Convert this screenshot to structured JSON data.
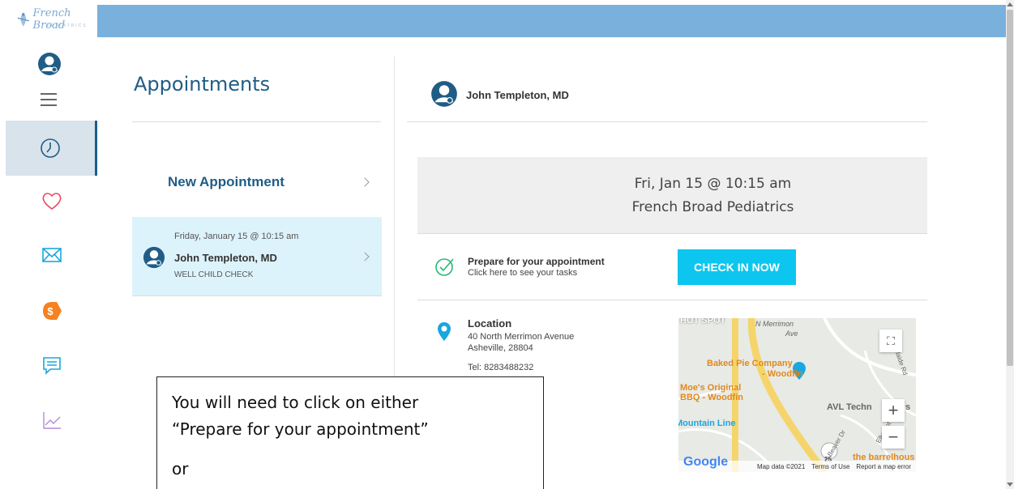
{
  "logo": {
    "text": "French Broad",
    "sub": "PEDIATRICS"
  },
  "nav": {
    "items": [
      {
        "name": "appointments",
        "icon": "clock-icon",
        "active": true
      },
      {
        "name": "health",
        "icon": "heart-icon",
        "active": false
      },
      {
        "name": "messages",
        "icon": "envelope-icon",
        "active": false
      },
      {
        "name": "billing",
        "icon": "dollar-icon",
        "active": false
      },
      {
        "name": "chat",
        "icon": "chat-icon",
        "active": false
      },
      {
        "name": "trends",
        "icon": "chart-icon",
        "active": false
      }
    ]
  },
  "appointments": {
    "title": "Appointments",
    "new_label": "New Appointment",
    "list": [
      {
        "date": "Friday, January 15 @ 10:15 am",
        "doctor": "John Templeton, MD",
        "type": "WELL CHILD CHECK"
      }
    ]
  },
  "detail": {
    "doctor": "John Templeton, MD",
    "when": "Fri, Jan 15 @ 10:15 am",
    "where": "French Broad Pediatrics",
    "prepare_title": "Prepare for your appointment",
    "prepare_sub": "Click here to see your tasks",
    "checkin_label": "CHECK IN NOW",
    "location_title": "Location",
    "address1": "40 North Merrimon Avenue",
    "address2": "Asheville, 28804",
    "phone": "Tel: 8283488232"
  },
  "map": {
    "labels": {
      "hotspot": "HOT SPOT",
      "street1": "N Merrimon",
      "street_ave": "Ave",
      "bakery1": "Baked Pie Company",
      "bakery2": "- Woodfin",
      "bbq1": "Moe's Original",
      "bbq2": "BBQ - Woodfin",
      "avl": "AVL Techn",
      "avl_s": "s",
      "mountain": "Mountain Line",
      "barrel": "the barrelhous",
      "street2": "Elkmont Dr",
      "street3": "Beaver Dr",
      "street4": "Adelaide Rd",
      "route": "25"
    },
    "google": "Google",
    "footer": [
      "Map data ©2021",
      "Terms of Use",
      "Report a map error"
    ],
    "zoom_in": "+",
    "zoom_out": "−"
  },
  "callout": {
    "line1": "You will need to click on either",
    "line2": "“Prepare for your appointment”",
    "line3": "or"
  },
  "colors": {
    "brand_blue": "#1f5d86",
    "band": "#7ab0dc",
    "checkin": "#0dc6ef",
    "selected_row": "#ddf3fb"
  }
}
